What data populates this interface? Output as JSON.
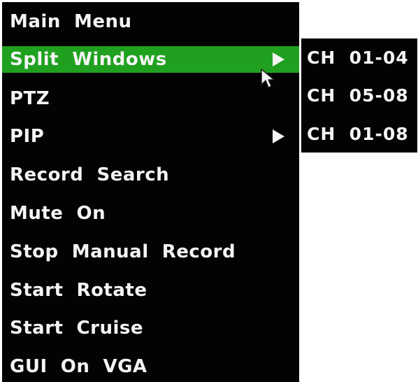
{
  "main_menu": {
    "title": "Main  Menu",
    "items": [
      {
        "label": "Split  Windows",
        "selected": true,
        "has_submenu": true
      },
      {
        "label": "PTZ",
        "selected": false,
        "has_submenu": false
      },
      {
        "label": "PIP",
        "selected": false,
        "has_submenu": true
      },
      {
        "label": "Record  Search",
        "selected": false,
        "has_submenu": false
      },
      {
        "label": "Mute  On",
        "selected": false,
        "has_submenu": false
      },
      {
        "label": "Stop  Manual  Record",
        "selected": false,
        "has_submenu": false
      },
      {
        "label": "Start  Rotate",
        "selected": false,
        "has_submenu": false
      },
      {
        "label": "Start  Cruise",
        "selected": false,
        "has_submenu": false
      },
      {
        "label": "GUI  On  VGA",
        "selected": false,
        "has_submenu": false
      }
    ]
  },
  "split_windows_submenu": {
    "items": [
      {
        "label": "CH  01-04"
      },
      {
        "label": "CH  05-08"
      },
      {
        "label": "CH  01-08"
      }
    ]
  },
  "icons": {
    "submenu_arrow": "triangle-right-icon",
    "pointer": "mouse-pointer-icon"
  },
  "colors": {
    "menu_background": "#030303",
    "highlight": "#1fa11f",
    "text": "#f4f4f4"
  }
}
